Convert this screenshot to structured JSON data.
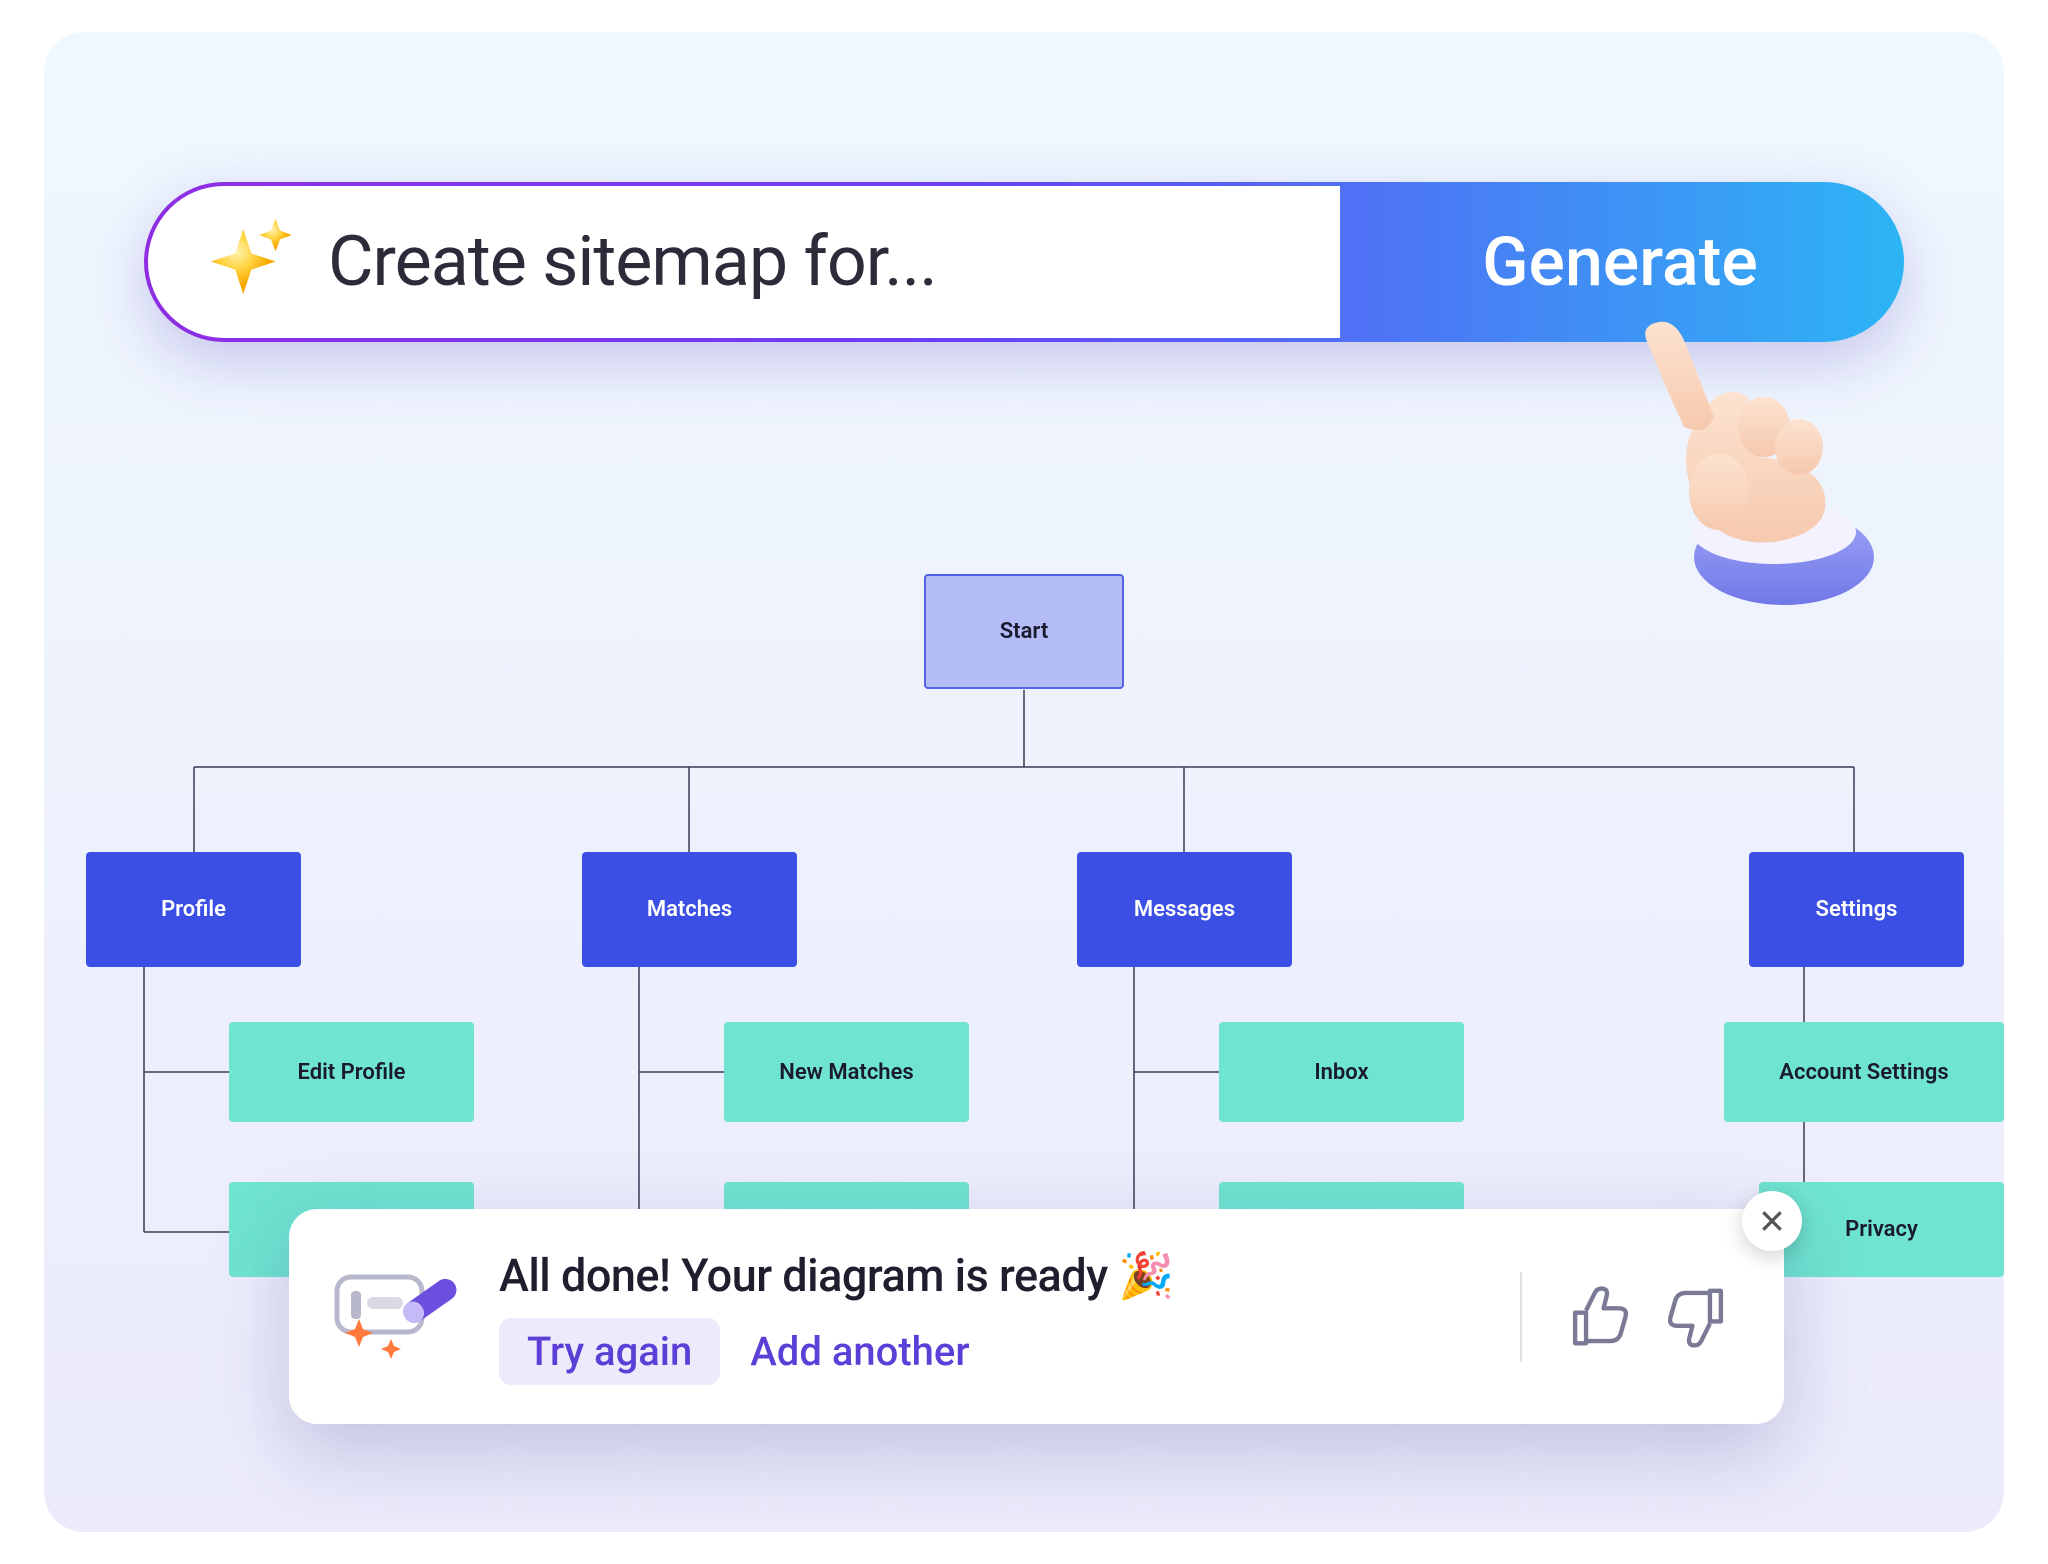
{
  "search": {
    "placeholder": "Create sitemap for...",
    "button_label": "Generate"
  },
  "diagram_nodes": {
    "start": "Start",
    "categories": [
      "Profile",
      "Matches",
      "Messages",
      "Settings"
    ],
    "leaves_row1": [
      "Edit Profile",
      "New Matches",
      "Inbox",
      "Account Settings"
    ],
    "leaves_row2_visible": [
      "Privacy"
    ]
  },
  "toast": {
    "title": "All done! Your diagram is ready 🎉",
    "try_again": "Try again",
    "add_another": "Add another"
  }
}
